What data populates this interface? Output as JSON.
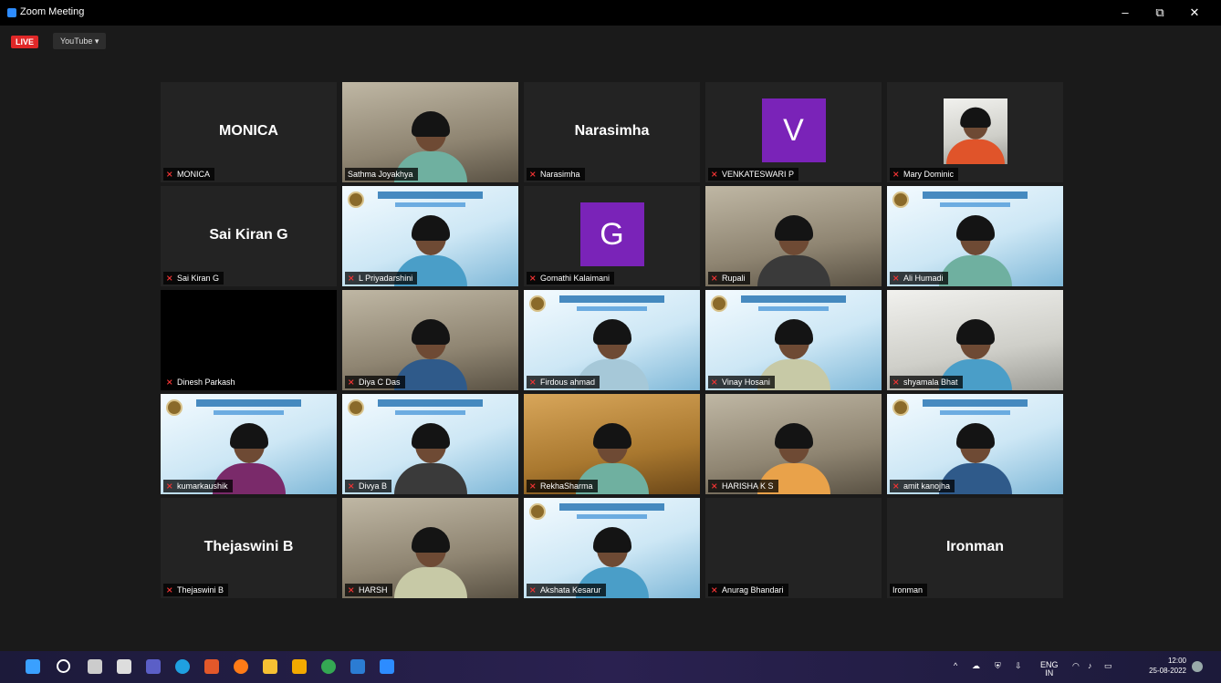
{
  "window": {
    "title": "Zoom Meeting",
    "minimize": "–",
    "restore": "⧉",
    "close": "✕"
  },
  "toolbar": {
    "live": "LIVE",
    "youtube": "YouTube ▾"
  },
  "participants": [
    {
      "name": "MONICA",
      "big": "MONICA",
      "type": "name",
      "muted": true
    },
    {
      "name": "Sathma Joyakhya",
      "type": "video",
      "muted": false,
      "active": true
    },
    {
      "name": "Narasimha",
      "big": "Narasimha",
      "type": "name",
      "muted": true
    },
    {
      "name": "VENKATESWARI P",
      "letter": "V",
      "type": "letter",
      "muted": true
    },
    {
      "name": "Mary Dominic",
      "type": "photo",
      "muted": true
    },
    {
      "name": "Sai Kiran G",
      "big": "Sai Kiran G",
      "type": "name",
      "muted": true
    },
    {
      "name": "L Priyadarshini",
      "type": "video",
      "muted": true
    },
    {
      "name": "Gomathi Kalaimani",
      "letter": "G",
      "type": "letter",
      "muted": true
    },
    {
      "name": "Rupali",
      "type": "video",
      "muted": true
    },
    {
      "name": "Ali Humadi",
      "type": "video",
      "muted": true
    },
    {
      "name": "Dinesh Parkash",
      "type": "black",
      "muted": true
    },
    {
      "name": "Diya C Das",
      "type": "video",
      "muted": true
    },
    {
      "name": "Firdous ahmad",
      "type": "video",
      "muted": true
    },
    {
      "name": "Vinay Hosani",
      "type": "video",
      "muted": true
    },
    {
      "name": "shyamala Bhat",
      "type": "video",
      "muted": true
    },
    {
      "name": "kumarkaushik",
      "type": "video",
      "muted": true
    },
    {
      "name": "Divya B",
      "type": "video",
      "muted": true
    },
    {
      "name": "RekhaSharma",
      "type": "video",
      "muted": true
    },
    {
      "name": "HARISHA K S",
      "type": "video",
      "muted": true
    },
    {
      "name": "amit kanojha",
      "type": "video",
      "muted": true
    },
    {
      "name": "Thejaswini B",
      "big": "Thejaswini B",
      "type": "name",
      "muted": true
    },
    {
      "name": "HARSH",
      "type": "video",
      "muted": true
    },
    {
      "name": "Akshata Kesarur",
      "type": "video",
      "muted": true
    },
    {
      "name": "Anurag Bhandari",
      "type": "name",
      "muted": true
    },
    {
      "name": "Ironman",
      "big": "Ironman",
      "type": "name",
      "muted": false
    }
  ],
  "taskbar": {
    "lang": "ENG",
    "region": "IN",
    "time": "12:00",
    "date": "25-08-2022"
  }
}
